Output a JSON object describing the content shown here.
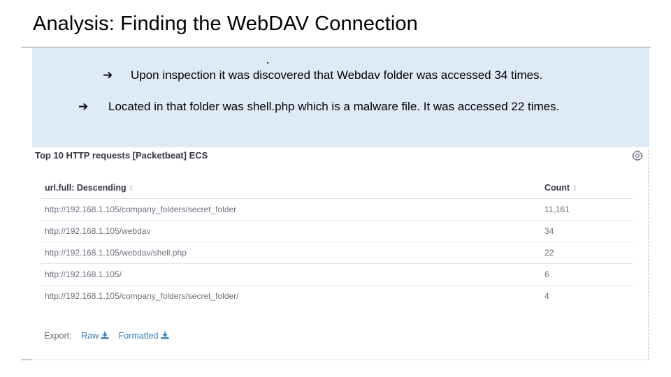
{
  "slide": {
    "title": "Analysis: Finding the WebDAV Connection",
    "bullets": [
      {
        "arrow": "➔",
        "text": "Upon inspection it was discovered that Webdav folder was accessed 34 times."
      },
      {
        "arrow": "➔",
        "text": "Located in that folder was shell.php which is a malware file. It was accessed 22 times."
      }
    ]
  },
  "panel": {
    "title": "Top 10 HTTP requests [Packetbeat] ECS",
    "icon": "gear-icon",
    "columns": [
      {
        "label": "url.full: Descending",
        "sort_icon": "⇕"
      },
      {
        "label": "Count",
        "sort_icon": "⇕"
      }
    ],
    "rows": [
      {
        "url": "http://192.168.1.105/company_folders/secret_folder",
        "count": "11,161"
      },
      {
        "url": "http://192.168.1.105/webdav",
        "count": "34"
      },
      {
        "url": "http://192.168.1.105/webdav/shell.php",
        "count": "22"
      },
      {
        "url": "http://192.168.1.105/",
        "count": "6"
      },
      {
        "url": "http://192.168.1.105/company_folders/secret_folder/",
        "count": "4"
      }
    ],
    "export": {
      "label": "Export:",
      "raw": "Raw",
      "formatted": "Formatted",
      "icon": "download-icon"
    }
  },
  "colors": {
    "bullet_box_bg": "#deebf7",
    "link": "#3a7fb8",
    "muted_text": "#69707d",
    "header_text": "#343741"
  }
}
